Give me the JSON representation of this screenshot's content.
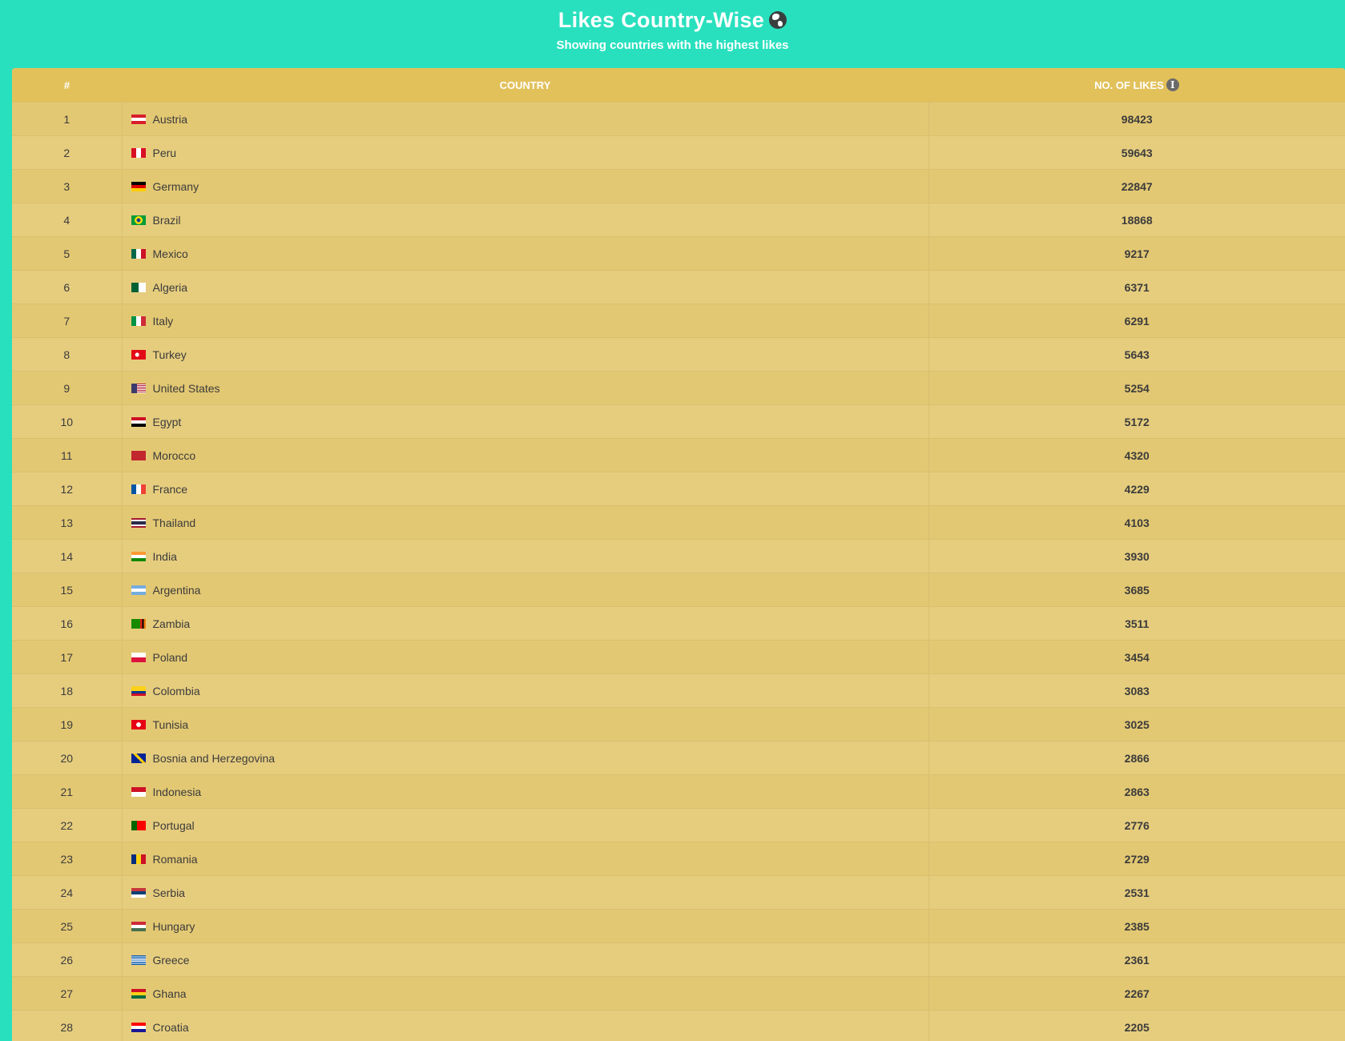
{
  "header": {
    "title": "Likes Country-Wise",
    "subtitle": "Showing countries with the highest likes"
  },
  "table": {
    "columns": [
      "#",
      "COUNTRY",
      "NO. OF LIKES"
    ],
    "rows": [
      {
        "rank": "1",
        "country": "Austria",
        "likes": "98423",
        "flag": "linear-gradient(#d81e2b 33%, #ffffff 33% 66%, #d81e2b 66%)"
      },
      {
        "rank": "2",
        "country": "Peru",
        "likes": "59643",
        "flag": "linear-gradient(90deg, #d91023 33%, #ffffff 33% 66%, #d91023 66%)"
      },
      {
        "rank": "3",
        "country": "Germany",
        "likes": "22847",
        "flag": "linear-gradient(#000000 33%, #dd0000 33% 66%, #ffce00 66%)"
      },
      {
        "rank": "4",
        "country": "Brazil",
        "likes": "18868",
        "flag": "radial-gradient(circle at 50% 50%, #1c3f94 22%, #fedf00 23% 45%, #009b3a 46%)"
      },
      {
        "rank": "5",
        "country": "Mexico",
        "likes": "9217",
        "flag": "linear-gradient(90deg, #006847 33%, #ffffff 33% 66%, #ce1126 66%)"
      },
      {
        "rank": "6",
        "country": "Algeria",
        "likes": "6371",
        "flag": "linear-gradient(90deg, #006233 50%, #ffffff 50%)"
      },
      {
        "rank": "7",
        "country": "Italy",
        "likes": "6291",
        "flag": "linear-gradient(90deg, #009246 33%, #ffffff 33% 66%, #ce2b37 66%)"
      },
      {
        "rank": "8",
        "country": "Turkey",
        "likes": "5643",
        "flag": "radial-gradient(circle at 40% 50%, #ffffff 20%, #e30a17 21%)"
      },
      {
        "rank": "9",
        "country": "United States",
        "likes": "5254",
        "flag": "linear-gradient(90deg, #3c3b6e 40%, transparent 40%), repeating-linear-gradient(#b22234 0 1px, #ffffff 1px 2px)"
      },
      {
        "rank": "10",
        "country": "Egypt",
        "likes": "5172",
        "flag": "linear-gradient(#ce1126 33%, #ffffff 33% 66%, #000000 66%)"
      },
      {
        "rank": "11",
        "country": "Morocco",
        "likes": "4320",
        "flag": "linear-gradient(#c1272d, #c1272d)"
      },
      {
        "rank": "12",
        "country": "France",
        "likes": "4229",
        "flag": "linear-gradient(90deg, #0055a4 33%, #ffffff 33% 66%, #ef4135 66%)"
      },
      {
        "rank": "13",
        "country": "Thailand",
        "likes": "4103",
        "flag": "linear-gradient(#a51931 17%, #f4f5f8 17% 33%, #2d2a4a 33% 67%, #f4f5f8 67% 83%, #a51931 83%)"
      },
      {
        "rank": "14",
        "country": "India",
        "likes": "3930",
        "flag": "linear-gradient(#ff9933 33%, #ffffff 33% 66%, #138808 66%)"
      },
      {
        "rank": "15",
        "country": "Argentina",
        "likes": "3685",
        "flag": "linear-gradient(#74acdf 33%, #ffffff 33% 66%, #74acdf 66%)"
      },
      {
        "rank": "16",
        "country": "Zambia",
        "likes": "3511",
        "flag": "linear-gradient(90deg, #198a00 62%, #de2010 62% 74%, #000000 74% 86%, #ef7d00 86%)"
      },
      {
        "rank": "17",
        "country": "Poland",
        "likes": "3454",
        "flag": "linear-gradient(#ffffff 50%, #dc143c 50%)"
      },
      {
        "rank": "18",
        "country": "Colombia",
        "likes": "3083",
        "flag": "linear-gradient(#fcd116 50%, #003893 50% 75%, #ce1126 75%)"
      },
      {
        "rank": "19",
        "country": "Tunisia",
        "likes": "3025",
        "flag": "radial-gradient(circle at 50% 50%, #ffffff 26%, #e70013 27%)"
      },
      {
        "rank": "20",
        "country": "Bosnia and Herzegovina",
        "likes": "2866",
        "flag": "linear-gradient(45deg, #002395 45%, #fecb00 45% 60%, #002395 60%)"
      },
      {
        "rank": "21",
        "country": "Indonesia",
        "likes": "2863",
        "flag": "linear-gradient(#ce1126 50%, #ffffff 50%)"
      },
      {
        "rank": "22",
        "country": "Portugal",
        "likes": "2776",
        "flag": "linear-gradient(90deg, #006600 40%, #ff0000 40%)"
      },
      {
        "rank": "23",
        "country": "Romania",
        "likes": "2729",
        "flag": "linear-gradient(90deg, #002b7f 33%, #fcd116 33% 66%, #ce1126 66%)"
      },
      {
        "rank": "24",
        "country": "Serbia",
        "likes": "2531",
        "flag": "linear-gradient(#c6363c 33%, #0c4076 33% 66%, #ffffff 66%)"
      },
      {
        "rank": "25",
        "country": "Hungary",
        "likes": "2385",
        "flag": "linear-gradient(#ce2939 33%, #ffffff 33% 66%, #477050 66%)"
      },
      {
        "rank": "26",
        "country": "Greece",
        "likes": "2361",
        "flag": "repeating-linear-gradient(#0d5eaf 0 1.33px, #ffffff 1.33px 2.66px)"
      },
      {
        "rank": "27",
        "country": "Ghana",
        "likes": "2267",
        "flag": "linear-gradient(#ce1126 33%, #fcd116 33% 66%, #006b3f 66%)"
      },
      {
        "rank": "28",
        "country": "Croatia",
        "likes": "2205",
        "flag": "linear-gradient(#ff0000 33%, #ffffff 33% 66%, #171796 66%)"
      }
    ]
  },
  "icons": {
    "title_icon": "globe-icon",
    "likes_header_icon": "info-icon"
  },
  "colors": {
    "page_background": "#29e0be",
    "header_row": "#e2c15b",
    "row_odd": "#e3c873",
    "row_even": "#e6cd7e"
  }
}
